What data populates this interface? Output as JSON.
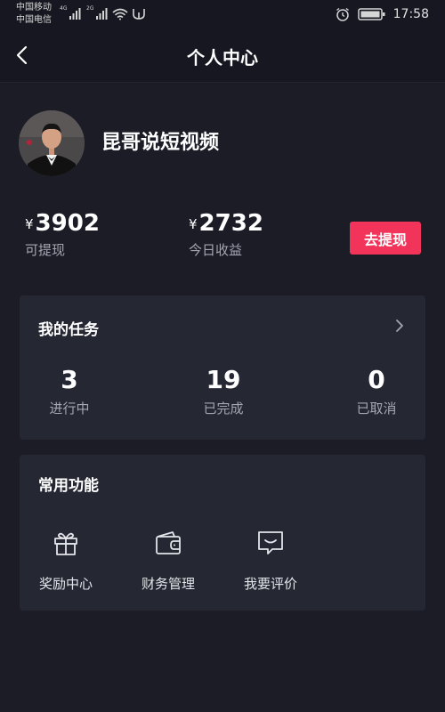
{
  "status_bar": {
    "carrier_1": "中国移动",
    "carrier_2": "中国电信",
    "net_1": "4G",
    "net_2": "2G",
    "time": "17:58",
    "icons": [
      "signal-icon",
      "wifi-icon",
      "usb-icon",
      "alarm-icon",
      "battery-icon"
    ]
  },
  "nav": {
    "title": "个人中心",
    "back_icon": "chevron-left-icon"
  },
  "profile": {
    "name": "昆哥说短视频",
    "avatar": "avatar-photo"
  },
  "balances": [
    {
      "currency": "¥",
      "amount": "3902",
      "label": "可提现"
    },
    {
      "currency": "¥",
      "amount": "2732",
      "label": "今日收益"
    }
  ],
  "withdraw_button": {
    "label": "去提现",
    "color": "#f2335a"
  },
  "tasks": {
    "title": "我的任务",
    "stats": [
      {
        "value": "3",
        "label": "进行中"
      },
      {
        "value": "19",
        "label": "已完成"
      },
      {
        "value": "0",
        "label": "已取消"
      }
    ]
  },
  "functions": {
    "title": "常用功能",
    "items": [
      {
        "label": "奖励中心",
        "icon": "gift-icon"
      },
      {
        "label": "财务管理",
        "icon": "wallet-icon"
      },
      {
        "label": "我要评价",
        "icon": "comment-icon"
      }
    ]
  },
  "colors": {
    "background": "#1b1c26",
    "card": "#252733",
    "accent": "#f2335a",
    "muted_text": "#a4a6b1"
  }
}
